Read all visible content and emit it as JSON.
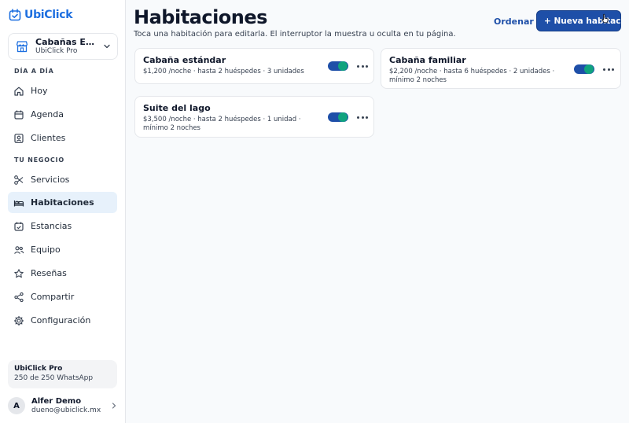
{
  "brand": {
    "name": "UbiClick",
    "color": "#1d6fe0"
  },
  "business": {
    "name": "Cabañas El Bosque",
    "plan_label": "UbiClick Pro"
  },
  "sections": {
    "day_to_day": "DÍA A DÍA",
    "your_business": "TU NEGOCIO"
  },
  "nav": {
    "hoy": "Hoy",
    "agenda": "Agenda",
    "clientes": "Clientes",
    "servicios": "Servicios",
    "habitaciones": "Habitaciones",
    "estancias": "Estancias",
    "equipo": "Equipo",
    "resenas": "Reseñas",
    "compartir": "Compartir",
    "configuracion": "Configuración"
  },
  "plan": {
    "name": "UbiClick Pro",
    "usage": "250 de 250 WhatsApp"
  },
  "user": {
    "initial": "A",
    "name": "Alfer Demo",
    "email": "dueno@ubiclick.mx"
  },
  "page": {
    "title": "Habitaciones",
    "subtitle": "Toca una habitación para editarla. El interruptor la muestra u oculta en tu página.",
    "order_label": "Ordenar",
    "new_button_label": "+ Nueva habitación"
  },
  "rooms": [
    {
      "name": "Cabaña estándar",
      "details": "$1,200 /noche · hasta 2 huéspedes · 3 unidades",
      "visible": true
    },
    {
      "name": "Cabaña familiar",
      "details": "$2,200 /noche · hasta 6 huéspedes · 2 unidades · mínimo 2 noches",
      "visible": true
    },
    {
      "name": "Suite del lago",
      "details": "$3,500 /noche · hasta 2 huéspedes · 1 unidad · mínimo 2 noches",
      "visible": true
    }
  ],
  "colors": {
    "accent": "#1e4fa8",
    "toggle_on": "#10a37f",
    "active_nav_bg": "#e7f1fb"
  }
}
